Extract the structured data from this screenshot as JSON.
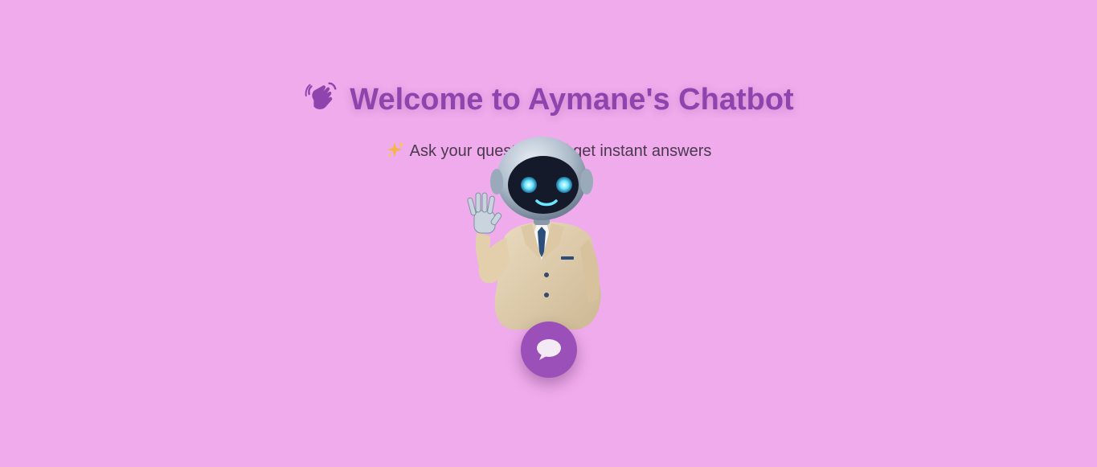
{
  "header": {
    "title": "Welcome to Aymane's Chatbot",
    "title_icon": "waving-hand-icon",
    "subtitle": "Ask your question and get instant answers",
    "subtitle_icon": "sparkles-icon"
  },
  "mascot": {
    "icon": "robot-mascot-waving-icon"
  },
  "chat_button": {
    "icon": "chat-bubble-icon"
  },
  "colors": {
    "background": "#efabec",
    "accent": "#8e44ad",
    "button": "#9b4fb9",
    "subtitle_text": "#4a3a4e"
  }
}
